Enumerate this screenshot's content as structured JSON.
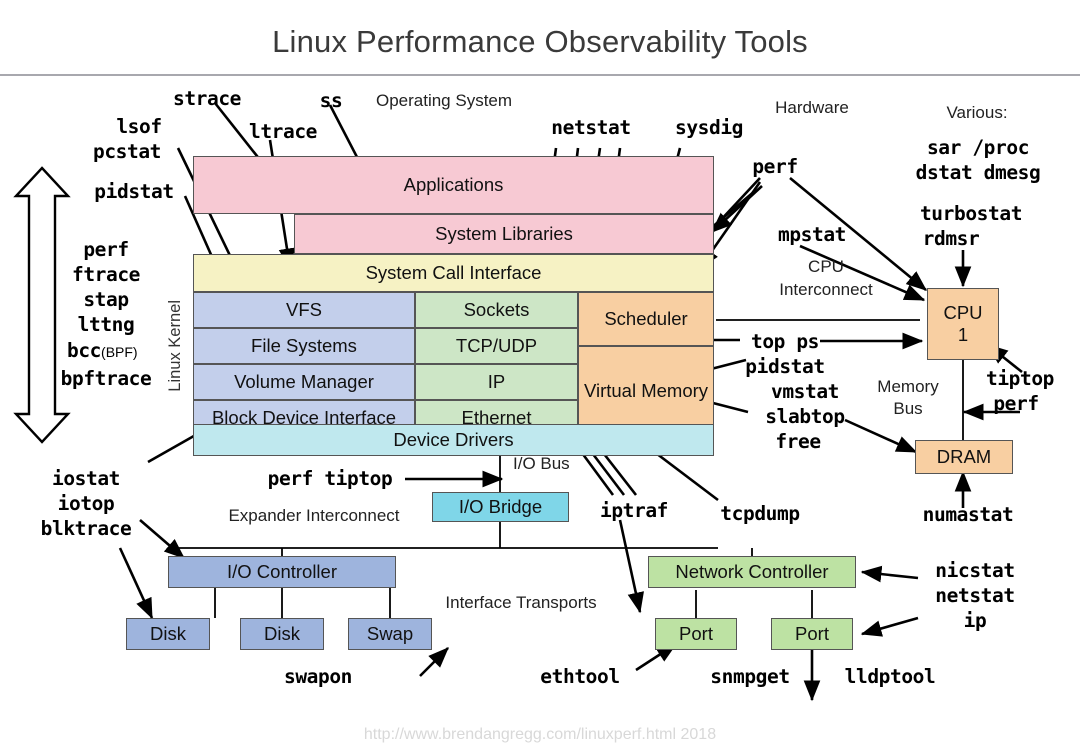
{
  "page": {
    "title": "Linux Performance Observability Tools",
    "footer": "http://www.brendangregg.com/linuxperf.html 2018"
  },
  "section_labels": {
    "operating_system": "Operating System",
    "hardware": "Hardware",
    "various": "Various:",
    "linux_kernel": "Linux Kernel",
    "cpu_interconnect_line1": "CPU",
    "cpu_interconnect_line2": "Interconnect",
    "memory_bus_line1": "Memory",
    "memory_bus_line2": "Bus",
    "io_bus": "I/O Bus",
    "expander_interconnect": "Expander Interconnect",
    "interface_transports": "Interface Transports"
  },
  "os_stack": {
    "applications": "Applications",
    "system_libraries": "System Libraries",
    "system_call_interface": "System Call Interface",
    "device_drivers": "Device Drivers",
    "file_column": [
      "VFS",
      "File Systems",
      "Volume Manager",
      "Block Device Interface"
    ],
    "net_column": [
      "Sockets",
      "TCP/UDP",
      "IP",
      "Ethernet"
    ],
    "cpu_column": [
      "Scheduler",
      "Virtual Memory"
    ]
  },
  "hardware_boxes": {
    "cpu": "CPU\n1",
    "cpu_line1": "CPU",
    "cpu_line2": "1",
    "dram": "DRAM",
    "io_bridge": "I/O Bridge",
    "io_controller": "I/O Controller",
    "network_controller": "Network Controller",
    "disk1": "Disk",
    "disk2": "Disk",
    "swap": "Swap",
    "port1": "Port",
    "port2": "Port"
  },
  "tools": {
    "strace": "strace",
    "ss": "ss",
    "lsof": "lsof",
    "pcstat": "pcstat",
    "ltrace": "ltrace",
    "netstat_top": "netstat",
    "sysdig": "sysdig",
    "pidstat_left": "pidstat",
    "perf_hw": "perf",
    "sar_proc": "sar /proc",
    "dstat_dmesg": "dstat dmesg",
    "mpstat": "mpstat",
    "turbostat": "turbostat",
    "rdmsr": "rdmsr",
    "perf_left": "perf",
    "ftrace": "ftrace",
    "stap": "stap",
    "lttng": "lttng",
    "bcc": "bcc",
    "bcc_suffix": "(BPF)",
    "bpftrace": "bpftrace",
    "top_ps": "top ps",
    "pidstat_right": "pidstat",
    "tiptop_mem": "tiptop",
    "perf_mem": "perf",
    "vmstat": "vmstat",
    "slabtop": "slabtop",
    "free": "free",
    "iostat": "iostat",
    "iotop": "iotop",
    "blktrace": "blktrace",
    "perf_tiptop": "perf tiptop",
    "iptraf": "iptraf",
    "tcpdump": "tcpdump",
    "numastat": "numastat",
    "swapon": "swapon",
    "ethtool": "ethtool",
    "snmpget": "snmpget",
    "lldptool": "lldptool",
    "nicstat": "nicstat",
    "netstat_right": "netstat",
    "ip": "ip"
  },
  "colors": {
    "pink": "#f7c9d3",
    "yellow": "#f6f2c4",
    "blue": "#c3cfeb",
    "green": "#cde6c6",
    "orange": "#f8cfa2",
    "cyan": "#bfe8ee",
    "dark_blue": "#9eb4dd",
    "dark_green": "#bde2a3",
    "dark_cyan": "#7fd6e8",
    "title_gray": "#3a3a3a"
  }
}
